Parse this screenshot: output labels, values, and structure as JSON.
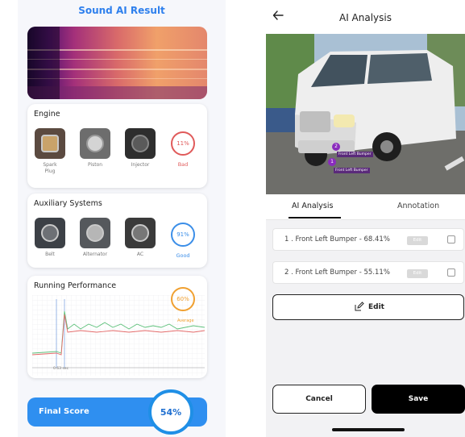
{
  "left": {
    "title": "Sound AI Result",
    "engine": {
      "title": "Engine",
      "items": [
        {
          "label": "Spark\nPlug"
        },
        {
          "label": "Piston"
        },
        {
          "label": "Injector"
        }
      ],
      "score": "11%",
      "status": "Bad"
    },
    "auxiliary": {
      "title": "Auxiliary Systems",
      "items": [
        {
          "label": "Belt"
        },
        {
          "label": "Alternator"
        },
        {
          "label": "AC"
        }
      ],
      "score": "91%",
      "status": "Good"
    },
    "performance": {
      "title": "Running Performance",
      "score": "60%",
      "legend": "Average",
      "axis_label": "0.63 sec"
    },
    "final": {
      "label": "Final Score",
      "score": "54%"
    },
    "colors": {
      "accent": "#2f80ed",
      "bad": "#e05a5a",
      "good": "#3b8ee8",
      "perf": "#f0a030"
    }
  },
  "right": {
    "title": "AI Analysis",
    "back_icon": "back-arrow-icon",
    "markers": [
      {
        "num": "2",
        "label": "Front Left Bumper"
      },
      {
        "num": "1",
        "label": "Front Left Bumper"
      }
    ],
    "tabs": [
      {
        "label": "AI Analysis",
        "active": true
      },
      {
        "label": "Annotation",
        "active": false
      }
    ],
    "results": [
      {
        "text": "1 . Front Left Bumper - 68.41%",
        "tag": "Edit",
        "checked": false
      },
      {
        "text": "2 . Front Left Bumper - 55.11%",
        "tag": "Edit",
        "checked": false
      }
    ],
    "edit_label": "Edit",
    "cancel_label": "Cancel",
    "save_label": "Save"
  }
}
